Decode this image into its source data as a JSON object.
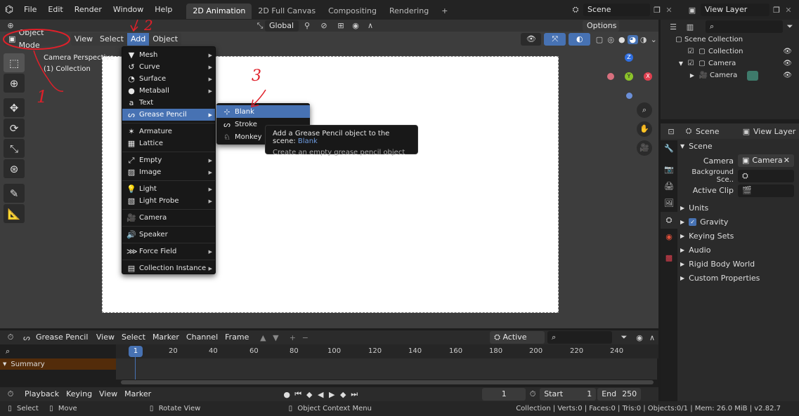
{
  "menubar": {
    "logo": "blender-logo-icon",
    "menus": [
      "File",
      "Edit",
      "Render",
      "Window",
      "Help"
    ],
    "tabs": [
      "2D Animation",
      "2D Full Canvas",
      "Compositing",
      "Rendering"
    ],
    "active_tab": "2D Animation",
    "add_tab": "+",
    "scene_label": "Scene",
    "view_layer_label": "View Layer"
  },
  "viewport_header": {
    "mode": "Object Mode",
    "menus": [
      "View",
      "Select",
      "Add",
      "Object"
    ],
    "active_menu": "Add",
    "orientation": "Global",
    "options": "Options"
  },
  "viewport": {
    "overlay_line1": "Camera Perspective",
    "overlay_line2": "(1) Collection",
    "gizmo": {
      "z": "Z",
      "y": "Y",
      "x": "X"
    },
    "colors": {
      "z": "#2f6ee0",
      "y": "#8cc32a",
      "x": "#e04050",
      "hl": "#4772b3"
    }
  },
  "add_menu": {
    "items": [
      {
        "icon": "mesh-icon",
        "label": "Mesh",
        "submenu": true
      },
      {
        "icon": "curve-icon",
        "label": "Curve",
        "submenu": true
      },
      {
        "icon": "surface-icon",
        "label": "Surface",
        "submenu": true
      },
      {
        "icon": "metaball-icon",
        "label": "Metaball",
        "submenu": true
      },
      {
        "icon": "text-icon",
        "label": "Text",
        "submenu": false
      },
      {
        "icon": "grease-pencil-icon",
        "label": "Grease Pencil",
        "submenu": true,
        "highlighted": true
      },
      {
        "icon": "armature-icon",
        "label": "Armature",
        "submenu": false
      },
      {
        "icon": "lattice-icon",
        "label": "Lattice",
        "submenu": false
      },
      {
        "icon": "empty-icon",
        "label": "Empty",
        "submenu": true
      },
      {
        "icon": "image-icon",
        "label": "Image",
        "submenu": true
      },
      {
        "icon": "light-icon",
        "label": "Light",
        "submenu": true
      },
      {
        "icon": "light-probe-icon",
        "label": "Light Probe",
        "submenu": true
      },
      {
        "icon": "camera-icon",
        "label": "Camera",
        "submenu": false
      },
      {
        "icon": "speaker-icon",
        "label": "Speaker",
        "submenu": false
      },
      {
        "icon": "force-field-icon",
        "label": "Force Field",
        "submenu": true
      },
      {
        "icon": "collection-instance-icon",
        "label": "Collection Instance",
        "submenu": true
      }
    ]
  },
  "grease_pencil_submenu": {
    "items": [
      "Blank",
      "Stroke",
      "Monkey"
    ],
    "highlighted": "Blank"
  },
  "tooltip": {
    "line1_prefix": "Add a Grease Pencil object to the scene:",
    "line1_value": "Blank",
    "line2": "Create an empty grease pencil object"
  },
  "annotations": {
    "one": "1",
    "two": "2",
    "three": "3"
  },
  "outliner": {
    "root": "Scene Collection",
    "items": [
      {
        "label": "Collection",
        "indent": 1
      },
      {
        "label": "Camera",
        "indent": 1
      },
      {
        "label": "Camera",
        "indent": 2
      }
    ]
  },
  "properties": {
    "scene_tab": "Scene",
    "view_layer_tab": "View Layer",
    "panel": "Scene",
    "camera_label": "Camera",
    "camera_value": "Camera",
    "bg_scene_label": "Background Sce..",
    "active_clip_label": "Active Clip",
    "sections": [
      "Units",
      "Gravity",
      "Keying Sets",
      "Audio",
      "Rigid Body World",
      "Custom Properties"
    ],
    "gravity_checked": true
  },
  "timeline_header": {
    "mode": "Grease Pencil",
    "menus": [
      "View",
      "Select",
      "Marker",
      "Channel",
      "Frame"
    ],
    "active_only": "Active Only"
  },
  "timeline": {
    "current_frame_badge": "1",
    "ticks": [
      "20",
      "40",
      "60",
      "80",
      "100",
      "120",
      "140",
      "160",
      "180",
      "200",
      "220",
      "240"
    ],
    "summary": "Summary"
  },
  "playback_header": {
    "menus": [
      "Playback",
      "Keying",
      "View",
      "Marker"
    ],
    "current_frame": "1",
    "start_label": "Start",
    "start": "1",
    "end_label": "End",
    "end": "250"
  },
  "statusbar": {
    "select": "Select",
    "move": "Move",
    "rotate": "Rotate View",
    "context": "Object Context Menu",
    "stats": "Collection | Verts:0 | Faces:0 | Tris:0 | Objects:0/1 | Mem: 26.0 MiB | v2.82.7"
  }
}
